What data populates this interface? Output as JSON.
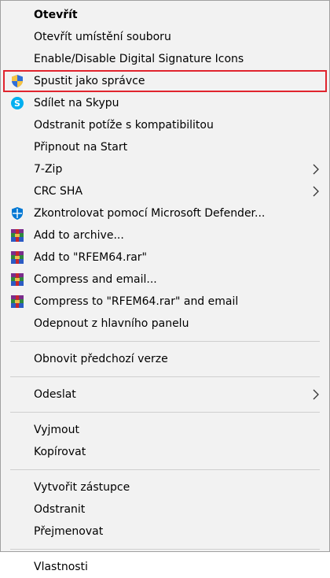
{
  "menu": {
    "items": [
      {
        "label": "Otevřít",
        "icon": null,
        "submenu": false,
        "bold": true
      },
      {
        "label": "Otevřít umístění souboru",
        "icon": null,
        "submenu": false
      },
      {
        "label": "Enable/Disable Digital Signature Icons",
        "icon": null,
        "submenu": false
      },
      {
        "label": "Spustit jako správce",
        "icon": "uac-shield-icon",
        "submenu": false,
        "highlighted": true
      },
      {
        "label": "Sdílet na Skypu",
        "icon": "skype-icon",
        "submenu": false
      },
      {
        "label": "Odstranit potíže s kompatibilitou",
        "icon": null,
        "submenu": false
      },
      {
        "label": "Připnout na Start",
        "icon": null,
        "submenu": false
      },
      {
        "label": "7-Zip",
        "icon": null,
        "submenu": true
      },
      {
        "label": "CRC SHA",
        "icon": null,
        "submenu": true
      },
      {
        "label": "Zkontrolovat pomocí Microsoft Defender...",
        "icon": "defender-icon",
        "submenu": false
      },
      {
        "label": "Add to archive...",
        "icon": "winrar-icon",
        "submenu": false
      },
      {
        "label": "Add to \"RFEM64.rar\"",
        "icon": "winrar-icon",
        "submenu": false
      },
      {
        "label": "Compress and email...",
        "icon": "winrar-icon",
        "submenu": false
      },
      {
        "label": "Compress to \"RFEM64.rar\" and email",
        "icon": "winrar-icon",
        "submenu": false
      },
      {
        "label": "Odepnout z hlavního panelu",
        "icon": null,
        "submenu": false
      },
      {
        "label": "Obnovit předchozí verze",
        "icon": null,
        "submenu": false
      },
      {
        "label": "Odeslat",
        "icon": null,
        "submenu": true
      },
      {
        "label": "Vyjmout",
        "icon": null,
        "submenu": false
      },
      {
        "label": "Kopírovat",
        "icon": null,
        "submenu": false
      },
      {
        "label": "Vytvořit zástupce",
        "icon": null,
        "submenu": false
      },
      {
        "label": "Odstranit",
        "icon": null,
        "submenu": false
      },
      {
        "label": "Přejmenovat",
        "icon": null,
        "submenu": false
      },
      {
        "label": "Vlastnosti",
        "icon": null,
        "submenu": false
      }
    ]
  },
  "colors": {
    "highlight_border": "#e0242e",
    "skype_blue": "#00aff0",
    "defender_blue": "#0078d4",
    "shield_yellow": "#f6c342",
    "shield_blue": "#2f6fd8"
  }
}
